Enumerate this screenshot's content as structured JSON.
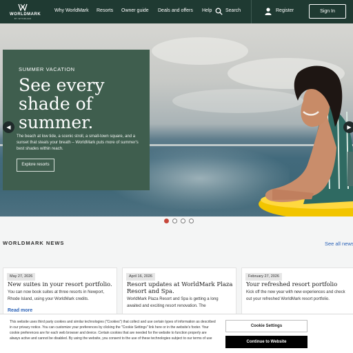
{
  "header": {
    "logo_word": "WORLDMARK",
    "logo_sub": "BY WYNDHAM",
    "nav_items": [
      "Why WorldMark",
      "Resorts",
      "Owner guide",
      "Deals and offers",
      "Help"
    ],
    "search_label": "Search",
    "register_label": "Register",
    "signin_label": "Sign In"
  },
  "hero": {
    "eyebrow": "SUMMER VACATION",
    "headline": [
      "See every",
      "shade of",
      "summer."
    ],
    "body": "The beach at low tide, a scenic stroll, a small-town square, and a sunset that steals your breath – WorldMark puts more of summer's best shades within reach.",
    "cta": "Explore resorts",
    "prev_icon": "chevron-left-icon",
    "next_icon": "chevron-right-icon",
    "slide_count": 4,
    "active_slide": 1
  },
  "news": {
    "title": "WORLDMARK NEWS",
    "see_all": "See all news",
    "read_more": "Read more",
    "cards": [
      {
        "date": "May 27, 2026",
        "title": "New suites in your resort portfolio.",
        "body": "You can now book suites at three resorts in Newport, Rhode Island, using your WorldMark credits."
      },
      {
        "date": "April 16, 2026",
        "title": "Resort updates at WorldMark Plaza Resort and Spa.",
        "body": "WorldMark Plaza Resort and Spa is getting a long awaited and exciting resort renovation. The"
      },
      {
        "date": "February 27, 2026",
        "title": "Your refreshed resort portfolio",
        "body": "Kick off the new year with new experiences and check out your refreshed WorldMark resort portfolio."
      }
    ]
  },
  "cookie": {
    "text": "This website uses third party cookies and similar technologies (\"Cookies\") that collect and use certain types of information as described in our privacy notice. You can customize your preferences by clicking the \"Cookie Settings\" link here or in the website's footer. Your cookie preferences are for each web browser and device. Certain cookies that are needed for the website to function properly are always active and cannot be disabled. By using the website, you consent to the use of these technologies subject to our terms of use",
    "settings_label": "Cookie Settings",
    "continue_label": "Continue to Website"
  },
  "colors": {
    "nav_bg": "#1f3a32",
    "hero_card_bg": "#3f5e4e",
    "link": "#2b62b7",
    "active_dot": "#c6463a"
  }
}
